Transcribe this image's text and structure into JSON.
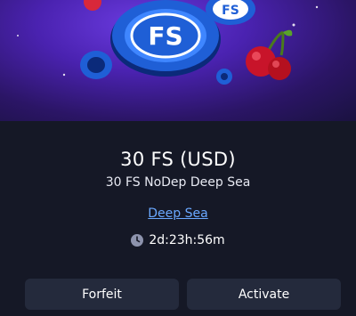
{
  "bonus": {
    "title": "30 FS (USD)",
    "subtitle": "30 FS NoDep Deep Sea",
    "game_link": "Deep Sea",
    "time_left": "2d:23h:56m"
  },
  "banner": {
    "chip_text_large": "FS",
    "chip_text_small": "FS"
  },
  "actions": {
    "forfeit_label": "Forfeit",
    "activate_label": "Activate"
  },
  "colors": {
    "background": "#151826",
    "button_bg": "#242a3c",
    "link": "#6aa8ff",
    "chip_blue": "#1f5fd6"
  },
  "icons": {
    "timer": "clock-icon"
  }
}
